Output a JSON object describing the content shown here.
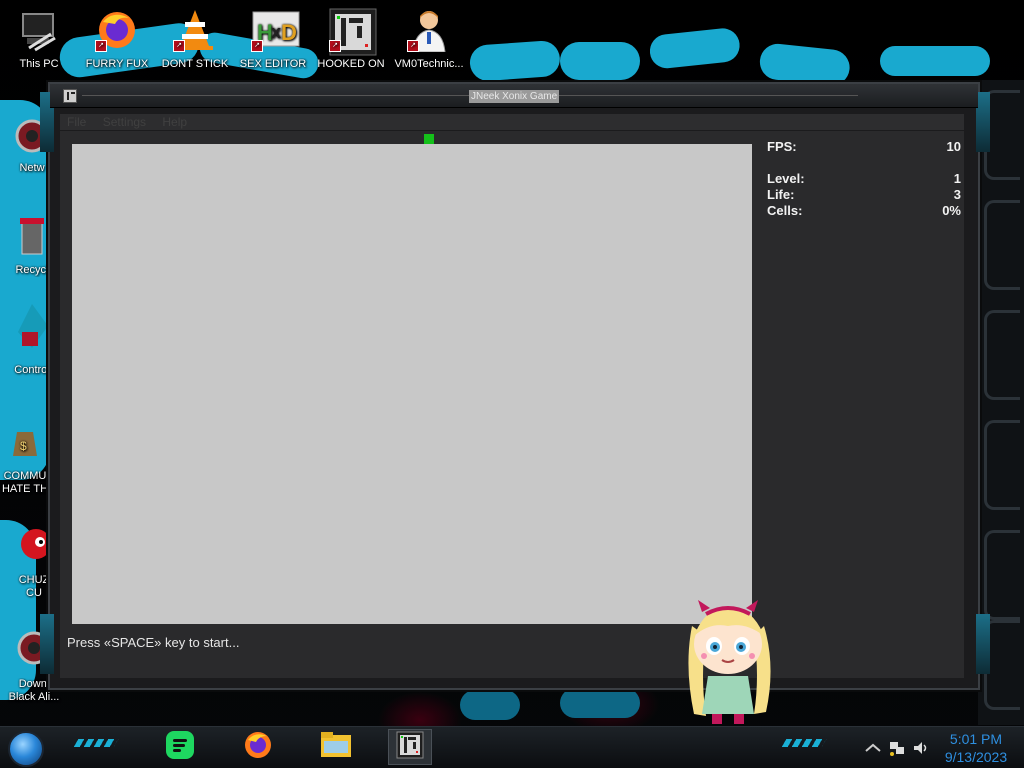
{
  "desktop": {
    "top_icons": [
      {
        "label": "This PC",
        "icon": "computer-icon"
      },
      {
        "label": "FURRY FUX",
        "icon": "firefox-icon"
      },
      {
        "label": "DONT STICK",
        "icon": "vlc-cone-icon"
      },
      {
        "label": "SEX EDITOR",
        "icon": "hxd-editor-icon"
      },
      {
        "label": "HOOKED ON",
        "icon": "xonix-game-icon"
      },
      {
        "label": "VM0Technic...",
        "icon": "doctor-avatar-icon"
      }
    ],
    "left_icons": [
      {
        "label": "Netw",
        "icon": "network-icon"
      },
      {
        "label": "Recycl",
        "icon": "recycle-bin-icon"
      },
      {
        "label": "Control",
        "icon": "control-panel-icon"
      },
      {
        "label": "COMMU",
        "label2": "HATE TH",
        "icon": "money-bag-icon"
      },
      {
        "label": "CHUZ",
        "label2": "CU",
        "icon": "red-creature-icon"
      },
      {
        "label": "Downl",
        "label2": "Black Ali...",
        "icon": "download-icon"
      }
    ]
  },
  "window": {
    "title": "JNeek Xonix Game",
    "menu": [
      "File",
      "Settings",
      "Help"
    ],
    "stats": {
      "fps_label": "FPS:",
      "fps_value": "10",
      "level_label": "Level:",
      "level_value": "1",
      "life_label": "Life:",
      "life_value": "3",
      "cells_label": "Cells:",
      "cells_value": "0%"
    },
    "status": "Press «SPACE» key to start..."
  },
  "taskbar": {
    "apps": [
      {
        "name": "spotify-icon"
      },
      {
        "name": "firefox-icon"
      },
      {
        "name": "file-explorer-icon"
      },
      {
        "name": "xonix-game-icon",
        "active": true
      }
    ],
    "clock_time": "5:01 PM",
    "clock_date": "9/13/2023"
  },
  "colors": {
    "accent": "#19a9cf",
    "playfield": "#c8c8c8",
    "player": "#14c01a",
    "clock": "#2e8fe0"
  }
}
